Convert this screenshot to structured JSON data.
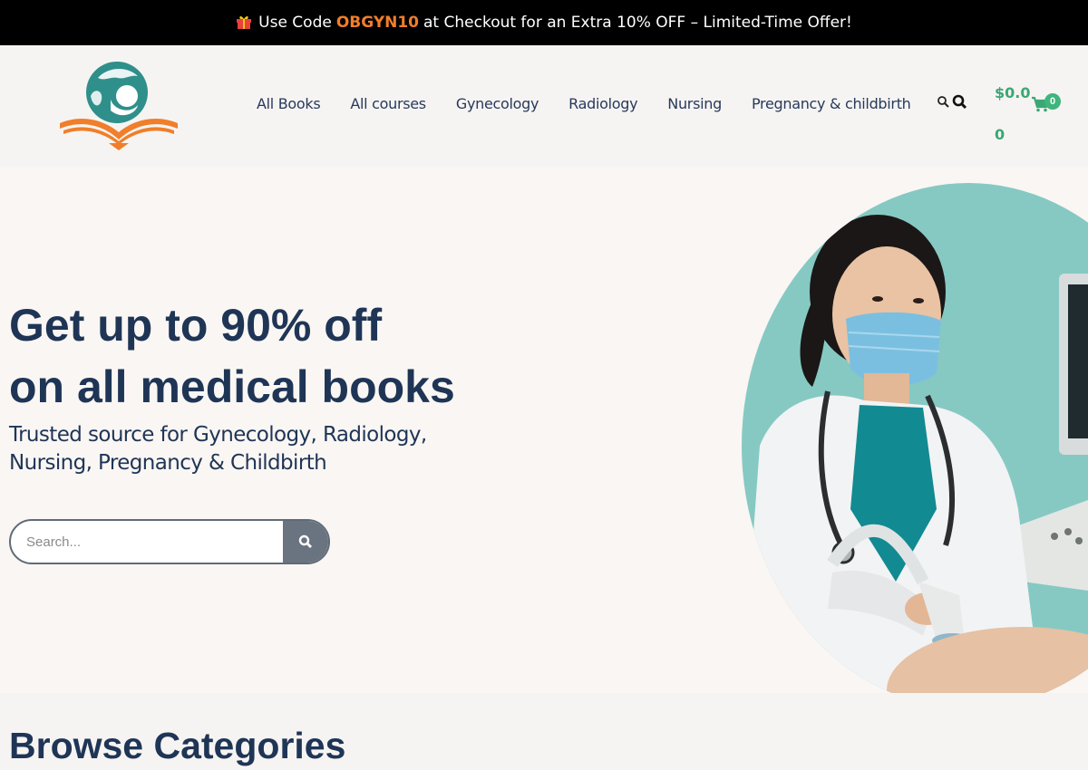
{
  "promo": {
    "prefix": "Use Code",
    "code": "OBGYN10",
    "suffix": "at Checkout for an Extra 10% OFF – Limited-Time Offer!",
    "gift_icon": "gift-icon"
  },
  "header": {
    "logo_icon": "book-globe-logo-icon",
    "nav": [
      {
        "label": "All Books"
      },
      {
        "label": "All courses"
      },
      {
        "label": "Gynecology"
      },
      {
        "label": "Radiology"
      },
      {
        "label": "Nursing"
      },
      {
        "label": "Pregnancy & childbirth"
      }
    ],
    "cart": {
      "amount": "$0.00",
      "count": "0",
      "icon": "cart-icon"
    }
  },
  "hero": {
    "title_line1": "Get up to 90% off",
    "title_line2": "on all medical books",
    "subtitle": "Trusted source for Gynecology, Radiology, Nursing, Pregnancy & Childbirth",
    "search_placeholder": "Search..."
  },
  "categories": {
    "title": "Browse Categories"
  },
  "colors": {
    "accent_orange": "#f07e2a",
    "navy": "#1f3556",
    "green": "#3aa874",
    "teal": "#7ec4bf"
  }
}
